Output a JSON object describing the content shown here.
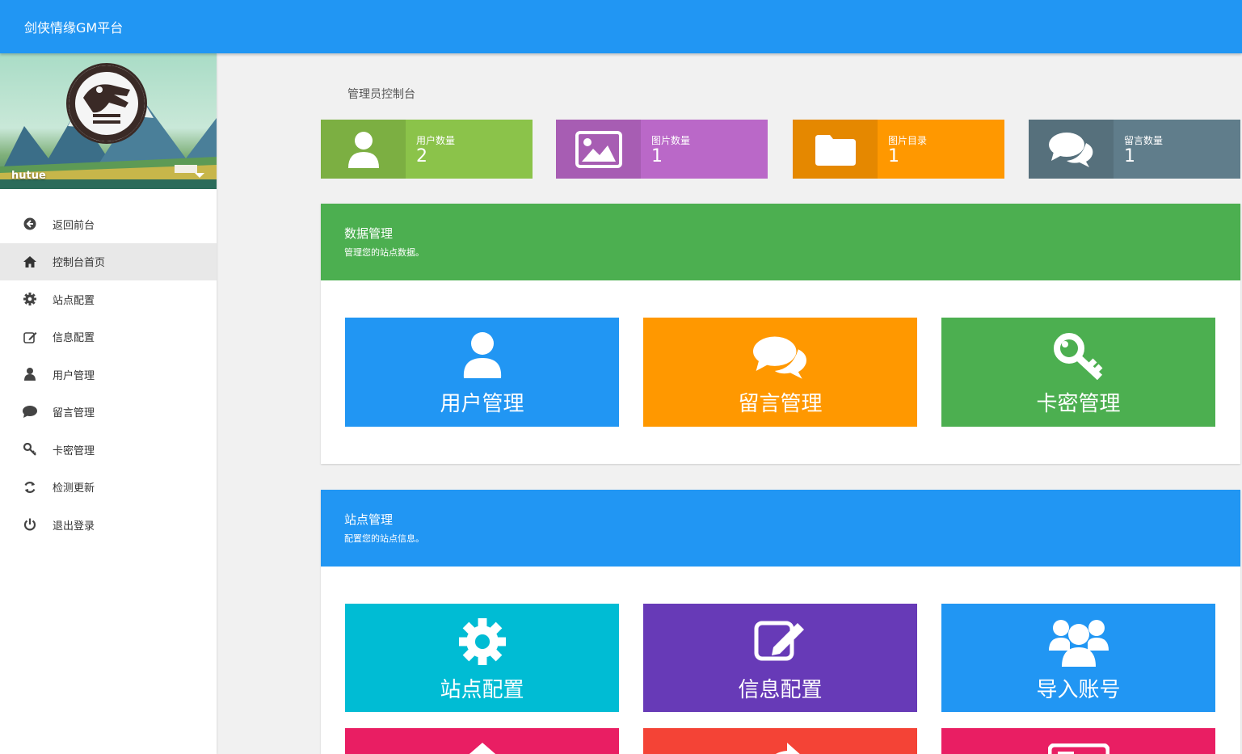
{
  "app": {
    "title": "剑侠情缘GM平台"
  },
  "sidebar": {
    "username": "hutue",
    "items": [
      {
        "label": "返回前台",
        "icon": "arrow-circle-left-icon"
      },
      {
        "label": "控制台首页",
        "icon": "home-icon"
      },
      {
        "label": "站点配置",
        "icon": "gear-icon"
      },
      {
        "label": "信息配置",
        "icon": "edit-icon"
      },
      {
        "label": "用户管理",
        "icon": "user-icon"
      },
      {
        "label": "留言管理",
        "icon": "comment-icon"
      },
      {
        "label": "卡密管理",
        "icon": "key-icon"
      },
      {
        "label": "检测更新",
        "icon": "refresh-icon"
      },
      {
        "label": "退出登录",
        "icon": "power-icon"
      }
    ]
  },
  "main": {
    "page_title": "管理员控制台",
    "stats": [
      {
        "label": "用户数量",
        "value": "2",
        "color": "#8bc34a",
        "icon": "user-icon"
      },
      {
        "label": "图片数量",
        "value": "1",
        "color": "#ba68c8",
        "icon": "image-icon"
      },
      {
        "label": "图片目录",
        "value": "1",
        "color": "#ff9800",
        "icon": "folder-icon"
      },
      {
        "label": "留言数量",
        "value": "1",
        "color": "#607d8b",
        "icon": "comments-icon"
      }
    ],
    "data_panel": {
      "title": "数据管理",
      "subtitle": "管理您的站点数据。",
      "color": "#4caf50",
      "tiles": [
        {
          "label": "用户管理",
          "color": "#2196f3",
          "icon": "user-icon"
        },
        {
          "label": "留言管理",
          "color": "#ff9800",
          "icon": "comments-icon"
        },
        {
          "label": "卡密管理",
          "color": "#4caf50",
          "icon": "key-icon"
        }
      ]
    },
    "site_panel": {
      "title": "站点管理",
      "subtitle": "配置您的站点信息。",
      "color": "#2196f3",
      "tiles": [
        {
          "label": "站点配置",
          "color": "#00bcd4",
          "icon": "gear-icon"
        },
        {
          "label": "信息配置",
          "color": "#673ab7",
          "icon": "edit-icon"
        },
        {
          "label": "导入账号",
          "color": "#2196f3",
          "icon": "users-icon"
        },
        {
          "label": "",
          "color": "#e91e63",
          "icon": "home-icon"
        },
        {
          "label": "",
          "color": "#f44336",
          "icon": "share-icon"
        },
        {
          "label": "",
          "color": "#e91e63",
          "icon": "card-icon"
        }
      ]
    }
  }
}
